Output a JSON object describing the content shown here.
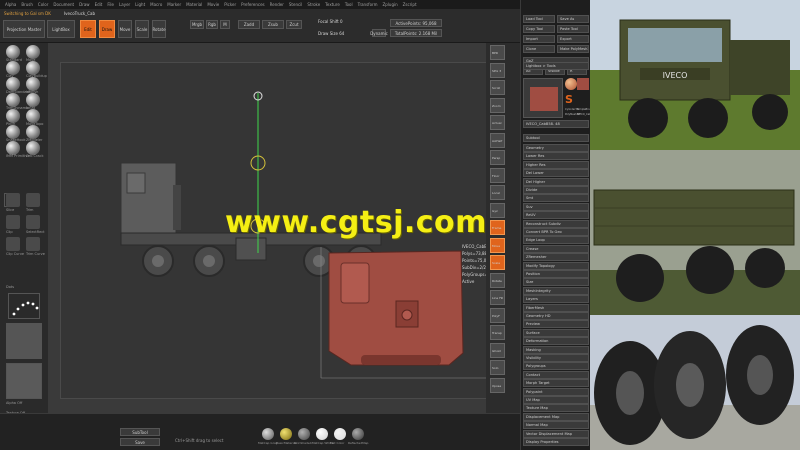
{
  "menu": {
    "items": [
      "Alpha",
      "Brush",
      "Color",
      "Document",
      "Draw",
      "Edit",
      "File",
      "Layer",
      "Light",
      "Macro",
      "Marker",
      "Material",
      "Movie",
      "Picker",
      "Preferences",
      "Render",
      "Stencil",
      "Stroke",
      "Texture",
      "Tool",
      "Transform",
      "Zplugin",
      "Zscript"
    ]
  },
  "toolbar": {
    "switch_label": "Switching to Gal sm DK",
    "tool_name": "IvecoTruck_Cab",
    "projection_master": "Projection Master",
    "lightbox": "LightBox",
    "quick_sketch": "Quick Sketch",
    "edit": "Edit",
    "draw": "Draw",
    "move": "Move",
    "scale": "Scale",
    "rotate": "Rotate",
    "mrgb": "Mrgb",
    "rgb": "Rgb",
    "m": "M",
    "zadd": "Zadd",
    "zsub": "Zsub",
    "zcut": "Zcut",
    "focal_shift": "Focal Shift 0",
    "draw_size": "Draw Size 64",
    "dynamic": "Dynamic",
    "active_points": "ActivePoints: 95,068",
    "total_points": "TotalPoints: 2.168 Mil"
  },
  "left_shelf": {
    "brushes": [
      "Standard",
      "Move",
      "Clay",
      "ClayBuildup",
      "DamStandard",
      "hPolish",
      "TrimDynamic",
      "Inflat",
      "Pinch",
      "MoveTopo",
      "SnakeHook",
      "ZModeler",
      "IMM Primitive",
      "Orb Crack"
    ],
    "tools": [
      "Slice",
      "Trim",
      "Clip",
      "SelectRect",
      "Clip Curve",
      "Trim Curve"
    ],
    "dot_label": "Dots",
    "alpha_label": "Alpha Off",
    "texture_label": "Texture Off",
    "material_label": "Material"
  },
  "right_shelf": {
    "buttons": [
      "BPR",
      "SPix 3",
      "Scroll",
      "Zoom",
      "Actual",
      "AAHalf",
      "Persp",
      "Floor",
      "Local",
      "Gyz",
      "Frame",
      "Move",
      "Scale",
      "Rotate",
      "Line Fill",
      "PolyF",
      "Transp",
      "Ghost",
      "Solo",
      "Xpose"
    ]
  },
  "canvas_info": {
    "lines": [
      "IVECO_CabB58",
      "Polys=73,880",
      "Points=75,068",
      "SubDiv=2/2",
      "PolyGroups=4",
      "Active"
    ]
  },
  "bottom": {
    "subtool_label": "SubTool",
    "save_label": "Save",
    "material_names": [
      "MatCap Gray",
      "BasicMaterial",
      "SkinShade4",
      "MatCap White",
      "Flat Color",
      "ReflectedMap"
    ],
    "status": "Ctrl+Shift drag to select"
  },
  "tray": {
    "buttons": [
      "Load Tool",
      "Save As",
      "Copy Tool",
      "Paste Tool",
      "Import",
      "Export",
      "Clone",
      "Make PolyMesh3D",
      "GoZ",
      "All",
      "Visible",
      "R",
      "Lightbox > Tools",
      "IVECO_CabB58. 48",
      "Subtool",
      "Geometry",
      "Lower Res",
      "Higher Res",
      "Del Lower",
      "Del Higher",
      "Divide",
      "Smt",
      "Suv",
      "ReUV",
      "Reconstruct Subdiv",
      "Convert BPR To Geo",
      "Edge Loop",
      "Crease",
      "ZRemesher",
      "Modify Topology",
      "Position",
      "Size",
      "MeshIntegrity",
      "Layers",
      "FiberMesh",
      "Geometry HD",
      "Preview",
      "Surface",
      "Deformation",
      "Masking",
      "Visibility",
      "Polygroups",
      "Contact",
      "Morph Target",
      "Polypaint",
      "UV Map",
      "Texture Map",
      "Displacement Map",
      "Normal Map",
      "Vector Displacement Map",
      "Display Properties",
      "Unified Skin",
      "Initialize",
      "Import",
      "Export"
    ],
    "tool_thumbnails": [
      "Cylinder3D",
      "SimpleBrush",
      "PolyMesh3D",
      "IVECO_CabB58"
    ]
  },
  "photos": {
    "truck_label": "IVECO"
  },
  "watermark": "www.cgtsj.com",
  "colors": {
    "accent_orange": "#e0641c",
    "watermark_yellow": "#f5ef14",
    "model_gray": "#5c5c5c",
    "selected_model": "#a04d42",
    "gizmo_green": "#3fd64a",
    "gizmo_yellow": "#d4c23a"
  }
}
